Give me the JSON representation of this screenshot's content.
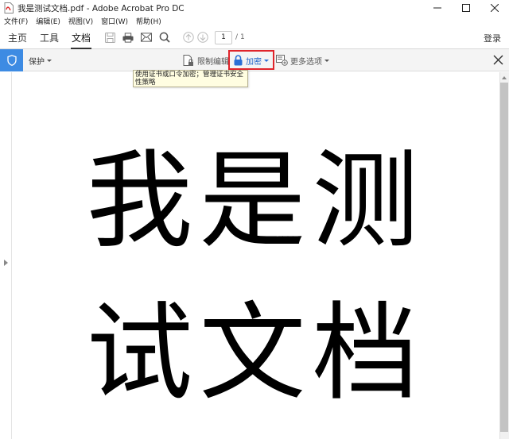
{
  "window": {
    "title": "我是测试文档.pdf - Adobe Acrobat Pro DC",
    "app_icon": "acrobat-pdf-icon"
  },
  "menu": [
    "文件(F)",
    "编辑(E)",
    "视图(V)",
    "窗口(W)",
    "帮助(H)"
  ],
  "toolbar": {
    "tabs": [
      "主页",
      "工具",
      "文档"
    ],
    "active_tab": "文档",
    "icons": [
      "save-icon",
      "print-icon",
      "email-icon",
      "search-icon",
      "page-up-icon",
      "page-down-icon"
    ],
    "page_current": "1",
    "page_total": "/ 1",
    "login": "登录"
  },
  "protection": {
    "label": "保护",
    "restrict_edit": "限制编辑",
    "encrypt": "加密",
    "more_options": "更多选项",
    "accent": "#3d8be3",
    "highlight": "#e0242b"
  },
  "tooltip": {
    "text": "使用证书或口令加密；管理证书安全性策略"
  },
  "document": {
    "line1": "我是测",
    "line2": "试文档"
  }
}
